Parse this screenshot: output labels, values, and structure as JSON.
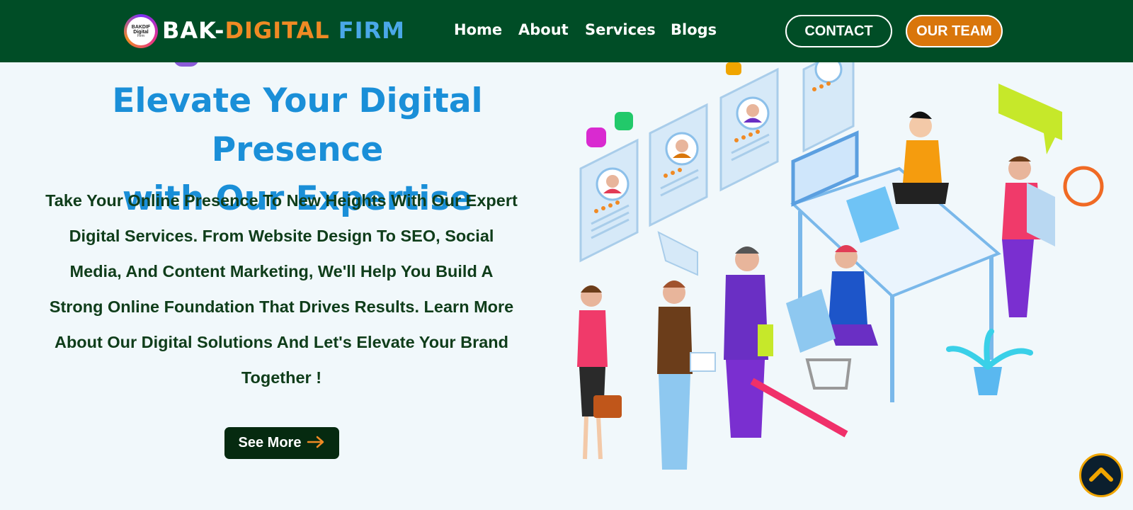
{
  "nav": {
    "logo": {
      "line1": "BAKDIF",
      "line2": "Digital",
      "line3": "Firm"
    },
    "brand": {
      "part1": "BAK-",
      "part2": "DIGITAL",
      "part3": " FIRM"
    },
    "links": [
      "Home",
      "About",
      "Services",
      "Blogs"
    ],
    "contact_label": "CONTACT",
    "team_label": "OUR TEAM"
  },
  "hero": {
    "title_line1": "Elevate Your Digital Presence",
    "title_line2": "with Our Expertise",
    "text": "Take Your Online Presence To New Heights With Our Expert Digital Services. From Website Design To SEO, Social Media, And Content Marketing, We'll Help You Build A Strong Online Foundation That Drives Results. Learn More About Our Digital Solutions And Let's Elevate Your Brand Together !",
    "cta_label": "See More"
  },
  "icons": {
    "cta_arrow": "arrow-right-icon",
    "scroll": "chevron-up-icon"
  },
  "colors": {
    "nav_bg": "#004d26",
    "title": "#1a8fd8",
    "accent_orange": "#f08a24",
    "accent_blue": "#4aa8e8",
    "body_text": "#0f3d1a"
  }
}
